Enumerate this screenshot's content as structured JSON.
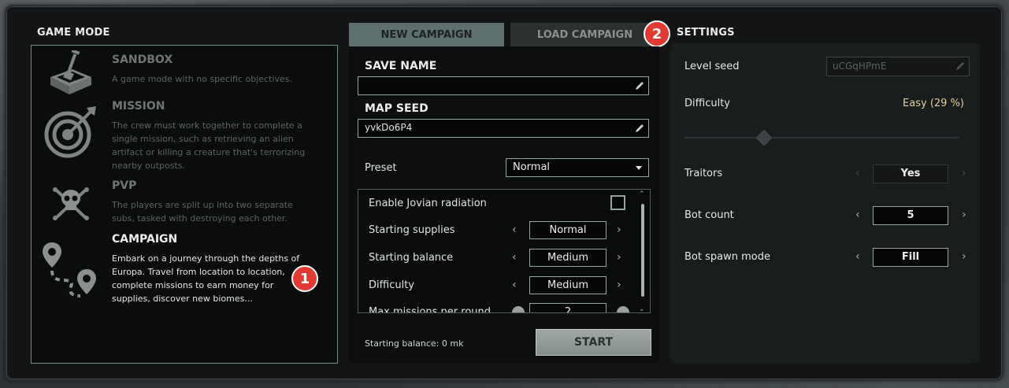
{
  "game_mode": {
    "title": "GAME MODE",
    "modes": [
      {
        "name": "SANDBOX",
        "description": "A game mode with no specific objectives.",
        "icon": "sandbox-shovel-icon"
      },
      {
        "name": "MISSION",
        "description": "The crew must work together to complete a single mission, such as retrieving an alien artifact or killing a creature that's terrorizing nearby outposts.",
        "icon": "target-icon"
      },
      {
        "name": "PVP",
        "description": "The players are split up into two separate subs, tasked with destroying each other.",
        "icon": "skull-crossbones-icon"
      },
      {
        "name": "CAMPAIGN",
        "description": "Embark on a journey through the depths of Europa. Travel from location to location, complete missions to earn money for supplies, discover new biomes...",
        "icon": "map-route-icon"
      }
    ],
    "selected": "CAMPAIGN"
  },
  "badges": {
    "one": "1",
    "two": "2"
  },
  "tabs": {
    "new_campaign": "NEW CAMPAIGN",
    "load_campaign": "LOAD CAMPAIGN"
  },
  "campaign": {
    "save_name_label": "SAVE NAME",
    "save_name_value": "",
    "map_seed_label": "MAP SEED",
    "map_seed_value": "yvkDo6P4",
    "preset_label": "Preset",
    "preset_value": "Normal",
    "options": {
      "jovian_label": "Enable Jovian radiation",
      "supplies_label": "Starting supplies",
      "supplies_value": "Normal",
      "balance_label": "Starting balance",
      "balance_value": "Medium",
      "difficulty_label": "Difficulty",
      "difficulty_value": "Medium",
      "max_missions_label": "Max missions per round",
      "max_missions_value": "2"
    },
    "starting_balance_text": "Starting balance: 0 mk",
    "start_label": "START"
  },
  "settings": {
    "title": "SETTINGS",
    "level_seed_label": "Level seed",
    "level_seed_value": "uCGqHPmE",
    "difficulty_label": "Difficulty",
    "difficulty_value": "Easy (29 %)",
    "difficulty_fraction": 0.29,
    "traitors_label": "Traitors",
    "traitors_value": "Yes",
    "bot_count_label": "Bot count",
    "bot_count_value": "5",
    "bot_spawn_label": "Bot spawn mode",
    "bot_spawn_value": "Fill"
  },
  "colors": {
    "accent_border": "#8fa59d",
    "badge_red": "#e03a33",
    "difficulty_text": "#e2cf9a",
    "tab_active": "#5f6f6e"
  }
}
